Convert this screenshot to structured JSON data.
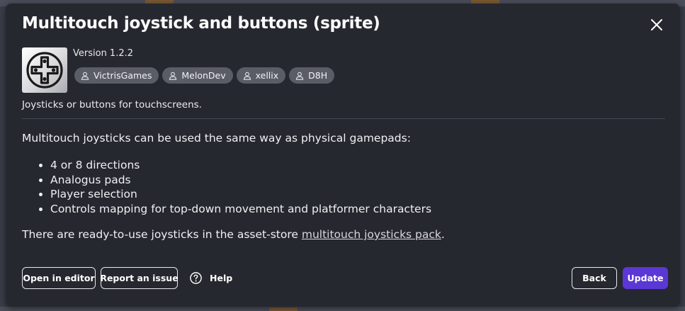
{
  "dialog": {
    "title": "Multitouch joystick and buttons (sprite)",
    "version": "Version 1.2.2",
    "authors": [
      "VictrisGames",
      "MelonDev",
      "xellix",
      "D8H"
    ],
    "short_description": "Joysticks or buttons for touchscreens.",
    "intro": "Multitouch joysticks can be used the same way as physical gamepads:",
    "features": [
      "4 or 8 directions",
      "Analogus pads",
      "Player selection",
      "Controls mapping for top-down movement and platformer characters"
    ],
    "footer_prefix": "There are ready-to-use joysticks in the asset-store ",
    "footer_link": "multitouch joysticks pack",
    "footer_suffix": "."
  },
  "actions": {
    "open_in_editor": "Open in editor",
    "report_issue": "Report an issue",
    "help": "Help",
    "back": "Back",
    "update": "Update"
  },
  "icons": {
    "close": "close-icon",
    "extension": "gamepad-dpad-icon",
    "author": "user-icon",
    "help": "question-circle-icon"
  },
  "colors": {
    "dialog_bg": "#26282f",
    "chip_bg": "#5a5d66",
    "primary": "#5b37d6"
  }
}
